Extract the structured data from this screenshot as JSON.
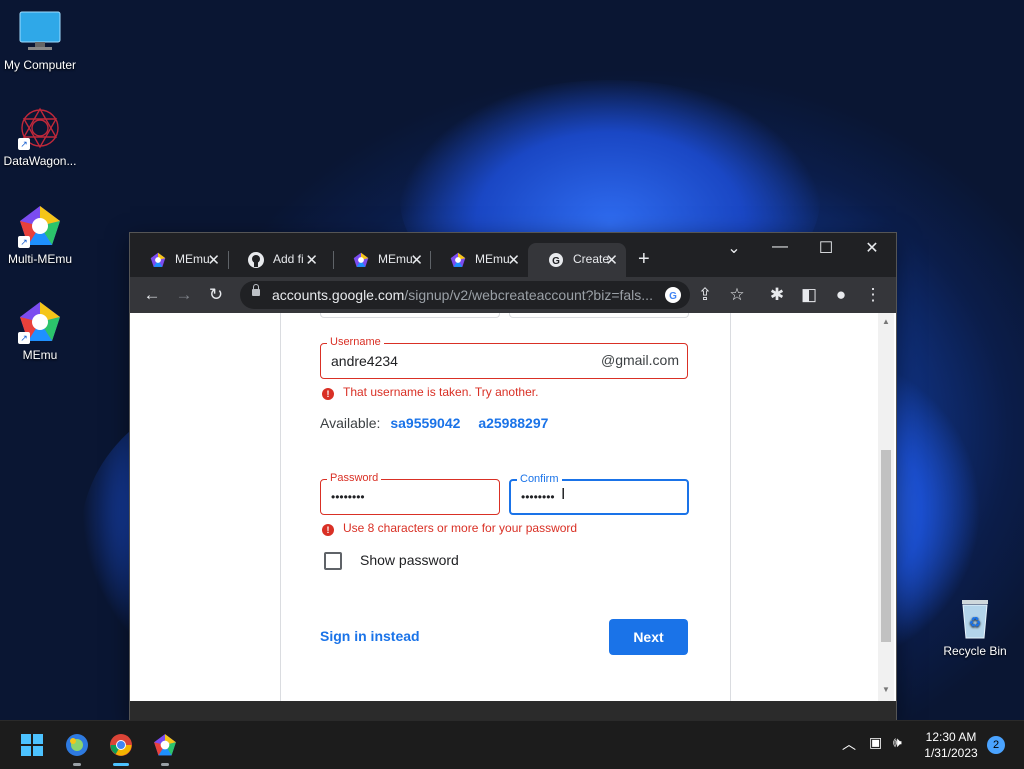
{
  "desktop": {
    "icons": [
      {
        "label": "My Computer",
        "icon": "monitor-icon"
      },
      {
        "label": "DataWagon...",
        "icon": "datawagon-icon"
      },
      {
        "label": "Multi-MEmu",
        "icon": "multi-memu-icon"
      },
      {
        "label": "MEmu",
        "icon": "memu-icon"
      },
      {
        "label": "Recycle Bin",
        "icon": "recycle-bin-icon"
      }
    ]
  },
  "browser": {
    "tabs": [
      {
        "label": "MEmu",
        "icon": "memu-icon"
      },
      {
        "label": "Add fi",
        "icon": "github-icon"
      },
      {
        "label": "MEmu",
        "icon": "memu-icon"
      },
      {
        "label": "MEmu",
        "icon": "memu-icon"
      },
      {
        "label": "Create",
        "icon": "google-icon",
        "active": true
      }
    ],
    "new_tab": "+",
    "url_domain": "accounts.google.com",
    "url_path": "/signup/v2/webcreateaccount?biz=fals..."
  },
  "form": {
    "username_label": "Username",
    "username_value": "andre4234",
    "username_suffix": "@gmail.com",
    "username_error": "That username is taken. Try another.",
    "available_label": "Available:",
    "suggestions": [
      "sa9559042",
      "a25988297"
    ],
    "password_label": "Password",
    "password_value": "••••••••",
    "confirm_label": "Confirm",
    "confirm_value": "••••••••",
    "password_error": "Use 8 characters or more for your password",
    "show_password_label": "Show password",
    "sign_in_label": "Sign in instead",
    "next_label": "Next"
  },
  "taskbar": {
    "time": "12:30 AM",
    "date": "1/31/2023",
    "notifications": "2"
  },
  "colors": {
    "accent": "#1a73e8",
    "error": "#d93025",
    "chrome_dark": "#202124"
  }
}
